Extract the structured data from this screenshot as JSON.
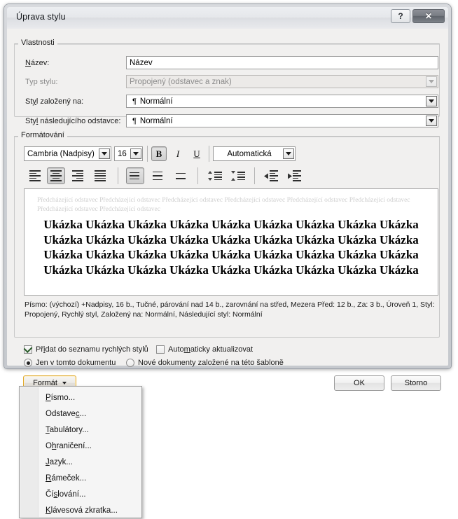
{
  "window": {
    "title": "Úprava stylu",
    "help_button": "?",
    "close_button": "✕"
  },
  "properties": {
    "group_label": "Vlastnosti",
    "fields": [
      {
        "label": "Název:",
        "accel": "N",
        "value": "Název",
        "type": "text",
        "disabled": false
      },
      {
        "label": "Typ stylu:",
        "accel": "T",
        "value": "Propojený (odstavec a znak)",
        "type": "combo",
        "disabled": true
      },
      {
        "label": "Styl založený na:",
        "accel": "y",
        "value": "Normální",
        "prefix": "¶",
        "type": "combo",
        "disabled": false
      },
      {
        "label": "Styl následujícího odstavce:",
        "accel": "l",
        "value": "Normální",
        "prefix": "¶",
        "type": "combo",
        "disabled": false
      }
    ]
  },
  "formatting": {
    "group_label": "Formátování",
    "font_name": "Cambria (Nadpisy)",
    "font_size": "16",
    "bold_label": "B",
    "italic_label": "I",
    "underline_label": "U",
    "font_color": "Automatická",
    "bold_active": true,
    "italic_active": false,
    "underline_active": false,
    "align_active_index": 1,
    "line_spacing_active_index": 0,
    "align_buttons": [
      "align-left",
      "align-center",
      "align-right",
      "align-justify"
    ],
    "spacing_buttons": [
      "line-spacing-single",
      "line-spacing-1-5",
      "line-spacing-double"
    ],
    "para_spacing_buttons": [
      "decrease-space-before",
      "increase-space-after"
    ],
    "indent_buttons": [
      "decrease-indent",
      "increase-indent"
    ]
  },
  "preview": {
    "preceding_text": "Předcházející odstavec Předcházející odstavec Předcházející odstavec Předcházející odstavec Předcházející odstavec Předcházející odstavec Předcházející odstavec Předcházející odstavec",
    "sample_text": "Ukázka Ukázka Ukázka Ukázka Ukázka Ukázka Ukázka Ukázka Ukázka Ukázka Ukázka Ukázka Ukázka Ukázka Ukázka Ukázka Ukázka Ukázka Ukázka Ukázka Ukázka Ukázka Ukázka Ukázka Ukázka Ukázka Ukázka Ukázka Ukázka Ukázka Ukázka Ukázka Ukázka Ukázka Ukázka Ukázka"
  },
  "description": "Písmo: (výchozí) +Nadpisy, 16 b., Tučné, párování nad 14 b., zarovnání na střed, Mezera Před:  12 b., Za:  3 b., Úroveň 1, Styl: Propojený, Rychlý styl, Založený na: Normální, Následující styl: Normální",
  "options": {
    "add_to_quick_styles": {
      "label": "Přidat do seznamu rychlých stylů",
      "checked": true
    },
    "auto_update": {
      "label": "Automaticky aktualizovat",
      "checked": false
    },
    "only_this_document": {
      "label": "Jen v tomto dokumentu",
      "selected": true
    },
    "new_documents": {
      "label": "Nové dokumenty založené na této šabloně",
      "selected": false
    }
  },
  "buttons": {
    "format": "Formát",
    "ok": "OK",
    "cancel": "Storno"
  },
  "format_menu": {
    "items": [
      {
        "label": "Písmo...",
        "accel": "P"
      },
      {
        "label": "Odstavec...",
        "accel": "c"
      },
      {
        "label": "Tabulátory...",
        "accel": "T"
      },
      {
        "label": "Ohraničení...",
        "accel": "h"
      },
      {
        "label": "Jazyk...",
        "accel": "J"
      },
      {
        "label": "Rámeček...",
        "accel": "R"
      },
      {
        "label": "Číslování...",
        "accel": "s"
      },
      {
        "label": "Klávesová zkratka...",
        "accel": "K"
      }
    ]
  },
  "colors": {
    "dialog_bg": "#f1f0ef",
    "frame": "#cdd0d5",
    "accent_highlight": "#e0a92b",
    "preview_placeholder": "#cfcfcf"
  }
}
